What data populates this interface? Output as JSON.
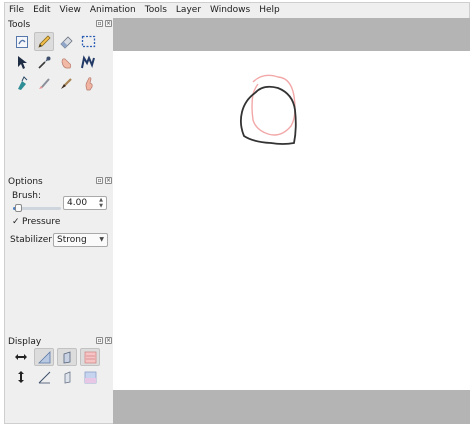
{
  "menu": [
    "File",
    "Edit",
    "View",
    "Animation",
    "Tools",
    "Layer",
    "Windows",
    "Help"
  ],
  "tools_panel": {
    "title": "Tools",
    "tools": [
      {
        "name": "select-layer-tool",
        "icon": "select-layer-icon",
        "active": false
      },
      {
        "name": "pencil-tool",
        "icon": "pencil-icon",
        "active": true
      },
      {
        "name": "eraser-tool",
        "icon": "eraser-icon",
        "active": false
      },
      {
        "name": "rect-select-tool",
        "icon": "rect-select-icon",
        "active": false
      },
      {
        "name": "pointer-tool",
        "icon": "pointer-icon",
        "active": false
      },
      {
        "name": "eyedropper-tool",
        "icon": "eyedropper-icon",
        "active": false
      },
      {
        "name": "hand-tool",
        "icon": "hand-icon",
        "active": false
      },
      {
        "name": "pen-tool",
        "icon": "pen-icon",
        "active": false
      },
      {
        "name": "bucket-tool",
        "icon": "bucket-icon",
        "active": false
      },
      {
        "name": "brush-tool",
        "icon": "brush-icon",
        "active": false
      },
      {
        "name": "ink-tool",
        "icon": "ink-icon",
        "active": false
      },
      {
        "name": "smudge-tool",
        "icon": "smudge-icon",
        "active": false
      }
    ]
  },
  "options_panel": {
    "title": "Options",
    "brush_label": "Brush:",
    "brush_value": "4.00",
    "brush_slider_fraction": 0.1,
    "pressure_label": "Pressure",
    "pressure_checked": "✓",
    "stabilizer_label": "Stabilizer",
    "stabilizer_value": "Strong"
  },
  "display_panel": {
    "title": "Display",
    "buttons": [
      {
        "name": "horizontal-flip-button",
        "icon": "horizontal-flip-icon",
        "on": false
      },
      {
        "name": "overlay-button",
        "icon": "overlay-icon",
        "on": true
      },
      {
        "name": "outlines-button",
        "icon": "outlines-icon",
        "on": true
      },
      {
        "name": "onion-prev-button",
        "icon": "onion-prev-icon",
        "on": true
      },
      {
        "name": "vertical-flip-button",
        "icon": "vertical-flip-icon",
        "on": false
      },
      {
        "name": "thin-lines-button",
        "icon": "thin-lines-icon",
        "on": false
      },
      {
        "name": "show-all-layers-button",
        "icon": "layers-icon",
        "on": false
      },
      {
        "name": "onion-next-button",
        "icon": "onion-next-icon",
        "on": false
      }
    ]
  },
  "colors": {
    "canvas_bg": "#ffffff",
    "canvas_surround": "#b4b4b4",
    "stroke_current": "#333333",
    "stroke_onion": "#f2a8a8"
  }
}
